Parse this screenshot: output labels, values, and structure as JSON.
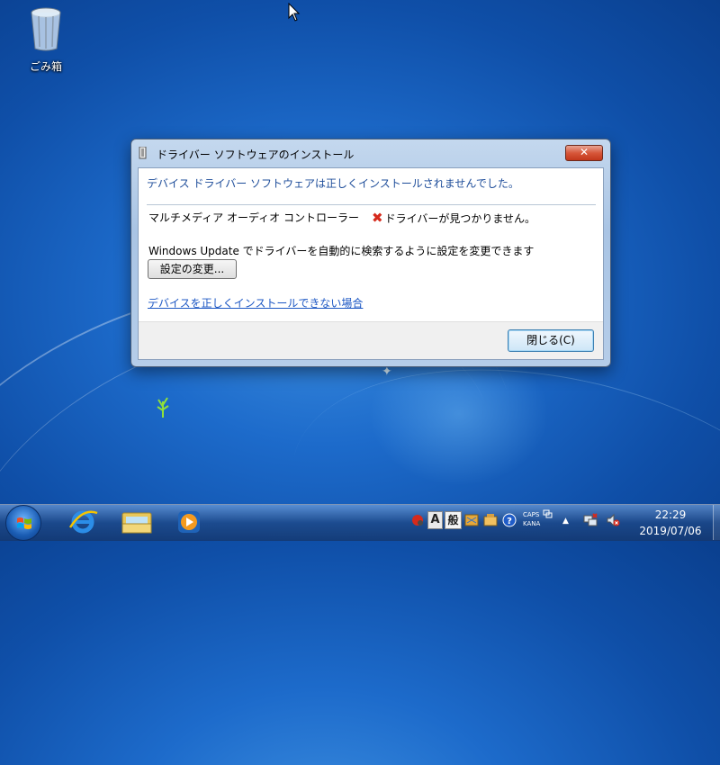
{
  "desktop": {
    "recycle_bin_label": "ごみ箱"
  },
  "dialog": {
    "title": "ドライバー ソフトウェアのインストール",
    "close_glyph": "✕",
    "headline": "デバイス ドライバー ソフトウェアは正しくインストールされませんでした。",
    "device_name": "マルチメディア オーディオ コントローラー",
    "status_icon": "error-x-icon",
    "status_text": "ドライバーが見つかりません。",
    "windows_update_text": "Windows Update でドライバーを自動的に検索するように設定を変更できます",
    "change_settings_label": "設定の変更...",
    "help_link": "デバイスを正しくインストールできない場合",
    "close_button_label": "閉じる(C)"
  },
  "taskbar": {
    "pinned": [
      "internet-explorer-icon",
      "windows-explorer-icon",
      "media-player-icon"
    ],
    "ime_mode": "A",
    "ime_kanji": "般",
    "caps": "CAPS",
    "kana": "KANA",
    "time": "22:29",
    "date": "2019/07/06"
  },
  "colors": {
    "desktop_blue": "#1d6bcb",
    "headline_blue": "#1e4d9a",
    "link_blue": "#1c57c4",
    "error_red": "#d62a1c",
    "close_red": "#d7573a"
  }
}
